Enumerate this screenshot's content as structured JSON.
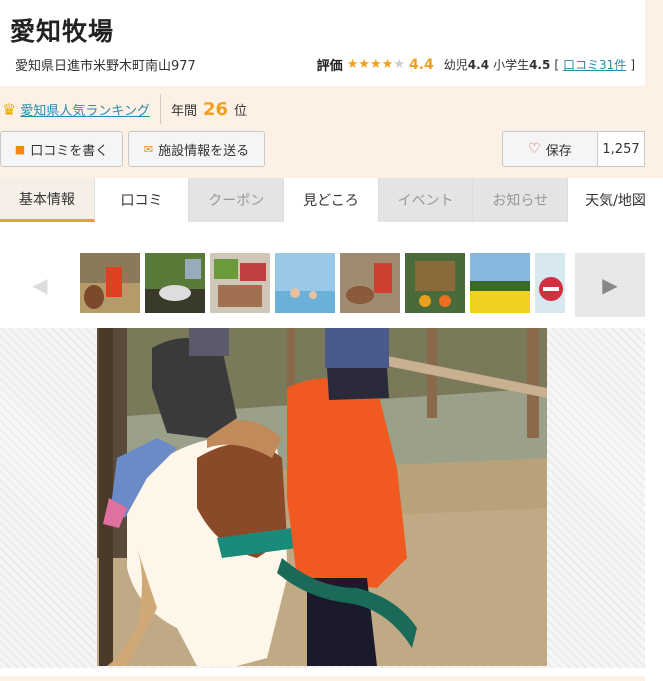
{
  "facility": {
    "name": "愛知牧場",
    "address": "愛知県日進市米野木町南山977"
  },
  "rating": {
    "label": "評価",
    "stars_filled": 4,
    "stars_total": 5,
    "score": "4.4",
    "infant_label": "幼児",
    "infant_score": "4.4",
    "elementary_label": "小学生",
    "elementary_score": "4.5",
    "reviews_link": "口コミ31件",
    "bracket_open": "[",
    "bracket_close": "]",
    "star_color": "#f0a020"
  },
  "ranking": {
    "link": "愛知県人気ランキング",
    "year_label": "年間",
    "rank": "26",
    "rank_suffix": "位"
  },
  "actions": {
    "write_review": "口コミを書く",
    "send_info": "施設情報を送る",
    "save": "保存",
    "save_count": "1,257"
  },
  "tabs": [
    {
      "label": "基本情報",
      "state": "active"
    },
    {
      "label": "口コミ",
      "state": "normal"
    },
    {
      "label": "クーポン",
      "state": "disabled"
    },
    {
      "label": "見どころ",
      "state": "normal"
    },
    {
      "label": "イベント",
      "state": "disabled"
    },
    {
      "label": "お知らせ",
      "state": "disabled"
    },
    {
      "label": "天気/地図",
      "state": "normal"
    }
  ],
  "gallery": {
    "thumbnail_count": 8,
    "main_photo_alt": "pony ride"
  },
  "colors": {
    "accent": "#f0a020",
    "link": "#2a8aa8",
    "page_bg": "#fdf1e6"
  }
}
